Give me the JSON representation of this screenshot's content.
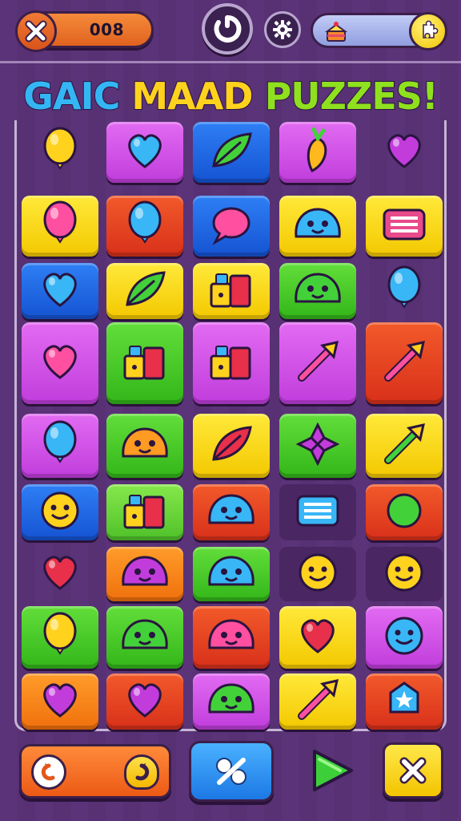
{
  "topbar": {
    "score": "008",
    "close_icon": "close-x-icon",
    "center_icon": "power-refresh-icon",
    "settings_icon": "gear-icon",
    "booster_icon": "cake-icon",
    "puzzle_icon": "puzzle-piece-icon"
  },
  "title": {
    "part1": "GAIC ",
    "part2": "MAAD ",
    "part3": "PUZZES!"
  },
  "colors": {
    "background": "#5b3378",
    "yellow": "#f3c800",
    "magenta": "#c03ddc",
    "blue": "#1553d2",
    "green": "#33b61a",
    "red": "#d8301a",
    "orange": "#f0700d"
  },
  "board": {
    "rows": [
      [
        {
          "color": "empty",
          "icon": "yellow-balloon-icon"
        },
        {
          "color": "magenta",
          "icon": "blue-heart-splash-icon"
        },
        {
          "color": "blue",
          "icon": "green-leaf-icon"
        },
        {
          "color": "magenta",
          "icon": "orange-carrot-icon"
        },
        {
          "color": "empty",
          "icon": "purple-heart-icon"
        }
      ],
      [
        {
          "color": "yellow",
          "icon": "pink-balloon-icon"
        },
        {
          "color": "red",
          "icon": "blue-balloon-icon"
        },
        {
          "color": "blue",
          "icon": "speech-bubble-icon"
        },
        {
          "color": "yellow",
          "icon": "blue-fish-icon"
        },
        {
          "color": "yellow",
          "icon": "keyboard-icon"
        }
      ],
      [
        {
          "color": "blue",
          "icon": "blue-heart-icon"
        },
        {
          "color": "yellow",
          "icon": "green-leaf-icon"
        },
        {
          "color": "yellow",
          "icon": "pink-toy-icon"
        },
        {
          "color": "green",
          "icon": "green-monster-icon"
        },
        {
          "color": "empty",
          "icon": "blue-balloon-icon"
        }
      ],
      [
        {
          "color": "magenta",
          "icon": "pink-hearts-icon"
        },
        {
          "color": "green",
          "icon": "toy-blocks-icon"
        },
        {
          "color": "magenta",
          "icon": "toy-blocks-icon"
        },
        {
          "color": "magenta",
          "icon": "crossed-tools-icon"
        },
        {
          "color": "red",
          "icon": "crossed-sword-icon"
        }
      ],
      [
        {
          "color": "magenta",
          "icon": "blue-balloon-icon"
        },
        {
          "color": "green",
          "icon": "orange-animal-icon"
        },
        {
          "color": "yellow",
          "icon": "red-leaf-cherry-icon"
        },
        {
          "color": "green",
          "icon": "flower-icon"
        },
        {
          "color": "yellow",
          "icon": "green-arrow-icon"
        }
      ],
      [
        {
          "color": "blue",
          "icon": "yellow-planet-icon"
        },
        {
          "color": "lime",
          "icon": "cheese-block-icon"
        },
        {
          "color": "red",
          "icon": "blue-cloud-icon"
        },
        {
          "color": "dark",
          "icon": "blue-list-icon"
        },
        {
          "color": "red",
          "icon": "green-smile-icon"
        }
      ],
      [
        {
          "color": "empty",
          "icon": "red-heart-icon"
        },
        {
          "color": "orange",
          "icon": "purple-monster-icon"
        },
        {
          "color": "green",
          "icon": "blue-monster-icon"
        },
        {
          "color": "dark",
          "icon": "yellow-smiley-icon"
        },
        {
          "color": "dark",
          "icon": "sun-face-icon"
        }
      ],
      [
        {
          "color": "green",
          "icon": "yellow-balloon-icon"
        },
        {
          "color": "green",
          "icon": "green-monster-icon"
        },
        {
          "color": "red",
          "icon": "pink-blob-icon"
        },
        {
          "color": "yellow",
          "icon": "red-heart-icon"
        },
        {
          "color": "magenta",
          "icon": "blue-flower-face-icon"
        }
      ],
      [
        {
          "color": "orange",
          "icon": "purple-heart-icon"
        },
        {
          "color": "red",
          "icon": "purple-heart-icon"
        },
        {
          "color": "magenta",
          "icon": "green-blob-icon"
        },
        {
          "color": "yellow",
          "icon": "pink-arrow-icon"
        },
        {
          "color": "red",
          "icon": "blue-star-icon"
        }
      ]
    ]
  },
  "bottombar": {
    "undo_icon": "undo-arrow-icon",
    "redo_icon": "redo-arrow-icon",
    "shuffle_icon": "shuffle-icon",
    "play_icon": "green-play-icon",
    "quit_icon": "close-x-icon"
  }
}
